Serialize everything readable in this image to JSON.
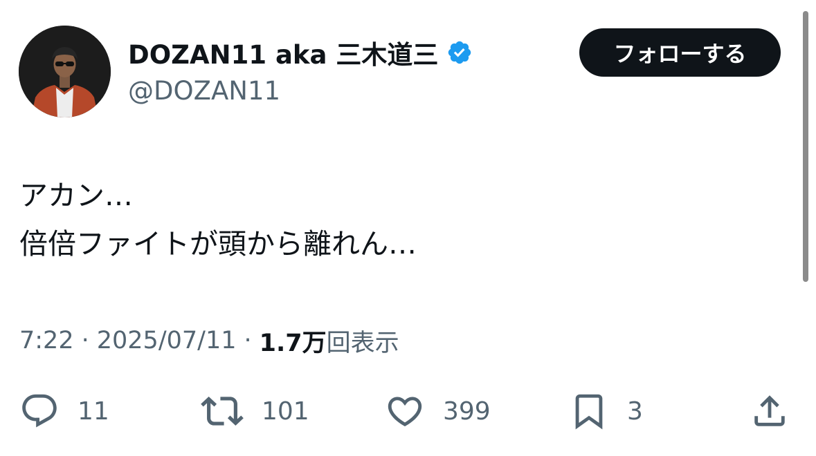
{
  "author": {
    "display_name": "DOZAN11 aka 三木道三",
    "handle": "@DOZAN11",
    "verified": true,
    "verified_color": "#1d9bf0"
  },
  "follow_button": {
    "label": "フォローする"
  },
  "tweet": {
    "lines": [
      "アカン…",
      "倍倍ファイトが頭から離れん…"
    ]
  },
  "meta": {
    "time": "7:22",
    "separator": "·",
    "date": "2025/07/11",
    "views_count": "1.7万",
    "views_label": "回表示"
  },
  "actions": {
    "reply": {
      "icon": "reply-icon",
      "count": "11"
    },
    "repost": {
      "icon": "repost-icon",
      "count": "101"
    },
    "like": {
      "icon": "heart-icon",
      "count": "399"
    },
    "bookmark": {
      "icon": "bookmark-icon",
      "count": "3"
    },
    "share": {
      "icon": "share-icon"
    }
  },
  "colors": {
    "text_primary": "#0f1419",
    "text_secondary": "#536471",
    "button_bg": "#0f1419",
    "icon": "#536471"
  }
}
